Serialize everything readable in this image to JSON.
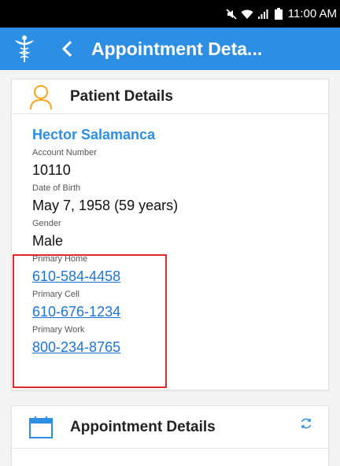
{
  "status_bar": {
    "time": "11:00 AM",
    "icons": [
      "mute-icon",
      "wifi-icon",
      "signal-icon",
      "battery-icon"
    ]
  },
  "app_bar": {
    "title": "Appointment Deta...",
    "background": "#2d8fe3",
    "logo_icon": "caduceus-icon",
    "back_icon": "chevron-left-icon"
  },
  "patient_card": {
    "header_title": "Patient Details",
    "icon": "person-outline-icon",
    "name": "Hector Salamanca",
    "account_label": "Account Number",
    "account_value": "10110",
    "dob_label": "Date of Birth",
    "dob_value": "May 7, 1958 (59 years)",
    "gender_label": "Gender",
    "gender_value": "Male",
    "home_label": "Primary Home",
    "home_phone": "610-584-4458",
    "cell_label": "Primary Cell",
    "cell_phone": "610-676-1234",
    "work_label": "Primary Work",
    "work_phone": "800-234-8765"
  },
  "appointment_card": {
    "header_title": "Appointment Details",
    "icon": "calendar-icon",
    "refresh_icon": "refresh-icon"
  },
  "colors": {
    "accent": "#2d8fe3",
    "link": "#1e74d6",
    "highlight": "#e3282e",
    "person_icon": "#f5a623"
  }
}
